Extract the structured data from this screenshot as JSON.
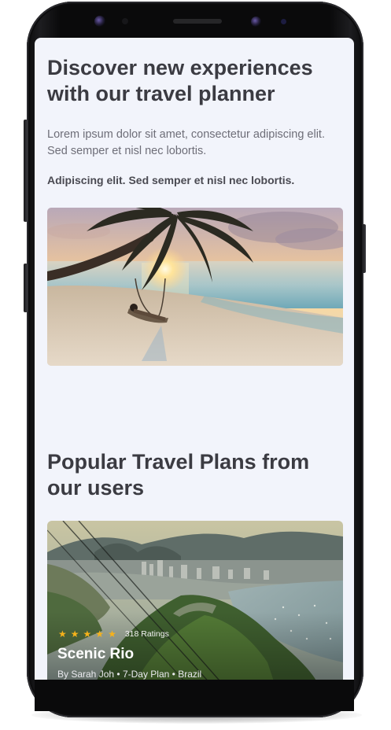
{
  "hero": {
    "title": "Discover new experiences with our travel planner",
    "body": "Lorem ipsum dolor sit amet, consectetur adipiscing elit. Sed semper et nisl nec lobortis.",
    "bold_text": "Adipiscing elit. Sed semper et nisl nec lobortis."
  },
  "popular": {
    "title": "Popular Travel Plans from our users"
  },
  "card": {
    "rating_stars": 5,
    "ratings_label": "318 Ratings",
    "title": "Scenic Rio",
    "author": "By Sarah Joh",
    "separator": "•",
    "plan": "7-Day Plan",
    "country": "Brazil"
  },
  "colors": {
    "background": "#f2f4fb",
    "heading": "#3b3b42",
    "body": "#6e6e78",
    "star": "#f6b21b",
    "device": "#0a0a0b"
  },
  "icons": {
    "star": "star-icon",
    "front_camera": "front-camera-icon"
  }
}
